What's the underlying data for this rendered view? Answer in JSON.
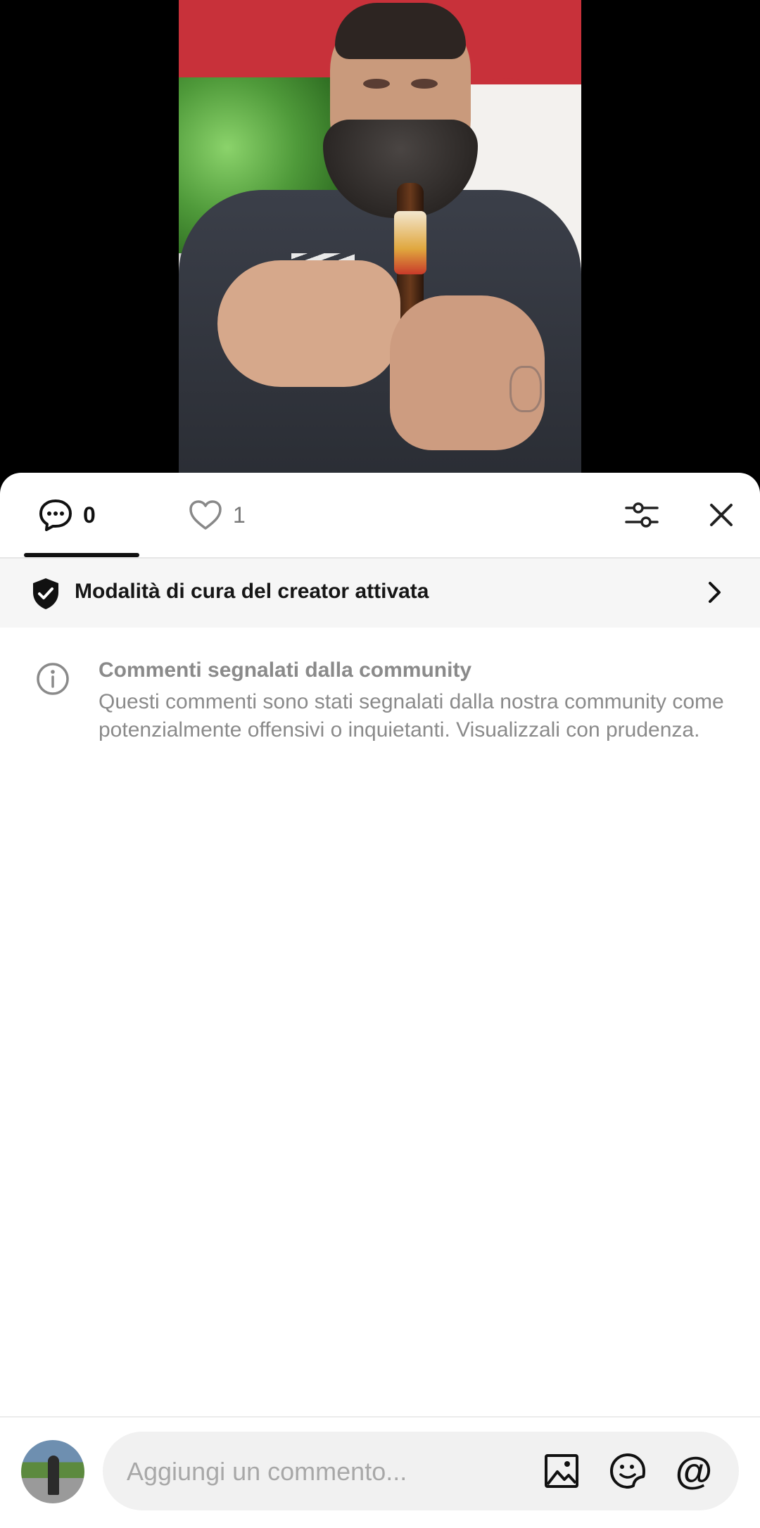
{
  "tabs": {
    "comments_count": "0",
    "likes_count": "1"
  },
  "banner": {
    "text": "Modalità di cura del creator attivata"
  },
  "notice": {
    "title": "Commenti segnalati dalla community",
    "body": "Questi commenti sono stati segnalati dalla nostra community come potenzialmente offensivi o inquietanti. Visualizzali con prudenza."
  },
  "composer": {
    "placeholder": "Aggiungi un commento...",
    "mention_symbol": "@"
  },
  "icons": {
    "comments_tab": "comment-bubble-icon",
    "likes_tab": "heart-icon",
    "filter": "sliders-icon",
    "close": "close-icon",
    "banner": "shield-check-icon",
    "banner_chevron": "chevron-right-icon",
    "notice": "info-icon",
    "image": "image-icon",
    "sticker": "sticker-icon",
    "mention": "at-icon"
  },
  "colors": {
    "active": "#111111",
    "muted": "#8a8a8a",
    "banner_bg": "#f6f6f6",
    "input_bg": "#f1f1f1"
  }
}
